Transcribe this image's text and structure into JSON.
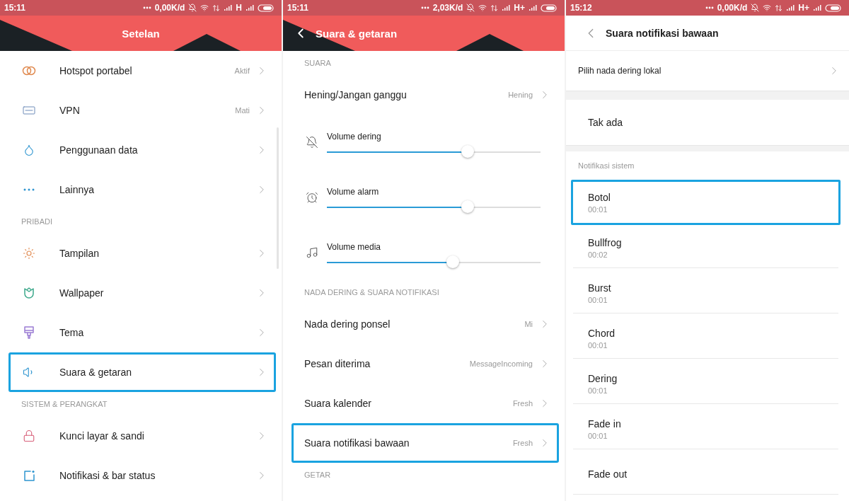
{
  "settings": {
    "status_bar": {
      "time": "15:11",
      "speed": "0,00K/d",
      "network": "H"
    },
    "title": "Setelan",
    "items": [
      {
        "kind": "row",
        "label": "Hotspot portabel",
        "value": "Aktif",
        "selected": false
      },
      {
        "kind": "row",
        "label": "VPN",
        "value": "Mati",
        "selected": false
      },
      {
        "kind": "row",
        "label": "Penggunaan data",
        "selected": false
      },
      {
        "kind": "row",
        "label": "Lainnya",
        "selected": false
      },
      {
        "kind": "header",
        "label": "PRIBADI"
      },
      {
        "kind": "row",
        "label": "Tampilan",
        "selected": false
      },
      {
        "kind": "row",
        "label": "Wallpaper",
        "selected": false
      },
      {
        "kind": "row",
        "label": "Tema",
        "selected": false
      },
      {
        "kind": "row",
        "label": "Suara & getaran",
        "selected": true
      },
      {
        "kind": "header",
        "label": "SISTEM & PERANGKAT"
      },
      {
        "kind": "row",
        "label": "Kunci layar & sandi",
        "selected": false
      },
      {
        "kind": "row",
        "label": "Notifikasi & bar status",
        "selected": false
      }
    ]
  },
  "sound": {
    "status_bar": {
      "time": "15:11",
      "speed": "2,03K/d",
      "network": "H+"
    },
    "title": "Suara & getaran",
    "items": [
      {
        "kind": "header",
        "label": "SUARA"
      },
      {
        "kind": "row",
        "label": "Hening/Jangan ganggu",
        "value": "Hening",
        "selected": false
      },
      {
        "kind": "slider",
        "label": "Volume dering",
        "level": 0.66
      },
      {
        "kind": "slider",
        "label": "Volume alarm",
        "level": 0.66
      },
      {
        "kind": "slider",
        "label": "Volume media",
        "level": 0.59
      },
      {
        "kind": "header",
        "label": "NADA DERING & SUARA NOTIFIKASI"
      },
      {
        "kind": "row",
        "label": "Nada dering ponsel",
        "value": "Mi",
        "selected": false
      },
      {
        "kind": "row",
        "label": "Pesan diterima",
        "value": "MessageIncoming",
        "selected": false
      },
      {
        "kind": "row",
        "label": "Suara kalender",
        "value": "Fresh",
        "selected": false
      },
      {
        "kind": "row",
        "label": "Suara notifikasi bawaan",
        "value": "Fresh",
        "selected": true
      },
      {
        "kind": "header",
        "label": "GETAR"
      }
    ]
  },
  "notification_sound": {
    "status_bar": {
      "time": "15:12",
      "speed": "0,00K/d",
      "network": "H+"
    },
    "title": "Suara notifikasi bawaan",
    "items": [
      {
        "kind": "link",
        "label": "Pilih nada dering lokal"
      },
      {
        "kind": "option",
        "label": "Tak ada"
      },
      {
        "kind": "header",
        "label": "Notifikasi sistem"
      },
      {
        "kind": "sound",
        "label": "Botol",
        "duration": "00:01",
        "selected": true
      },
      {
        "kind": "sound",
        "label": "Bullfrog",
        "duration": "00:02",
        "selected": false
      },
      {
        "kind": "sound",
        "label": "Burst",
        "duration": "00:01",
        "selected": false
      },
      {
        "kind": "sound",
        "label": "Chord",
        "duration": "00:01",
        "selected": false
      },
      {
        "kind": "sound",
        "label": "Dering",
        "duration": "00:01",
        "selected": false
      },
      {
        "kind": "sound",
        "label": "Fade in",
        "duration": "00:01",
        "selected": false
      },
      {
        "kind": "sound",
        "label": "Fade out",
        "selected": false
      }
    ]
  }
}
